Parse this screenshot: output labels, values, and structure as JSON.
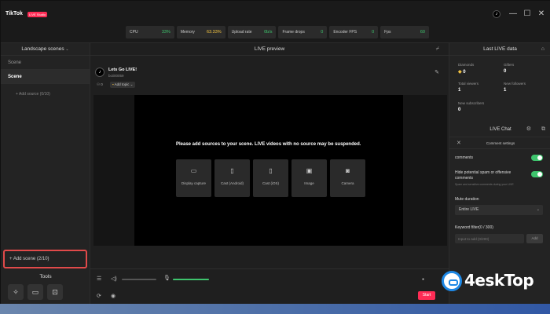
{
  "titlebar": {
    "app_name": "TikTok",
    "badge": "LIVE Studio",
    "tiktok_icon": "♪",
    "minimize": "—",
    "maximize": "☐",
    "close": "✕"
  },
  "stats": [
    {
      "label": "CPU",
      "value": "33%"
    },
    {
      "label": "Memory",
      "value": "63.33%"
    },
    {
      "label": "Upload rate",
      "value": "0b/s"
    },
    {
      "label": "Frame drops",
      "value": "0"
    },
    {
      "label": "Encoder FPS",
      "value": "0"
    },
    {
      "label": "Fps",
      "value": "60"
    }
  ],
  "left": {
    "header": "Landscape scenes",
    "scenes": [
      "Scene",
      "Scene"
    ],
    "add_source": "Add source (0/10)",
    "add_scene": "Add scene (2/10)",
    "tools_title": "Tools"
  },
  "center": {
    "header": "LIVE preview",
    "stream_title": "Lets Go LIVE!",
    "username": "boii00059",
    "viewers": "0",
    "add_topic": "Add topic",
    "message": "Please add sources to your scene. LIVE videos with no source may be suspended.",
    "tiles": [
      {
        "icon": "monitor-icon",
        "label": "Display capture"
      },
      {
        "icon": "phone-icon",
        "label": "Cast (Android)"
      },
      {
        "icon": "phone-icon",
        "label": "Cast (iOS)"
      },
      {
        "icon": "image-icon",
        "label": "Image"
      },
      {
        "icon": "camera-icon",
        "label": "Camera"
      }
    ],
    "start_label": "Start",
    "volume_level": 0,
    "mic_level": 1
  },
  "right": {
    "header": "Last LIVE data",
    "metrics": [
      {
        "label": "Diamonds",
        "value": "0"
      },
      {
        "label": "Gifters",
        "value": "0"
      },
      {
        "label": "Total viewers",
        "value": "1"
      },
      {
        "label": "New followers",
        "value": "1"
      },
      {
        "label": "New subscribers",
        "value": "0"
      }
    ],
    "chat_title": "LIVE Chat",
    "comment_settings": "Comment settings",
    "comments_label": "comments",
    "hide_spam_label": "Hide potential spam or offensive comments",
    "hide_spam_sub": "Spam and sensitive comments during your LIVE",
    "mute_duration_label": "Mute duration",
    "mute_duration_value": "Entire LIVE",
    "keyword_label": "Keyword filter(0 / 300)",
    "keyword_placeholder": "Input to add (0/200)",
    "keyword_add": "Add"
  },
  "watermark": {
    "text": "4eskTop"
  },
  "colors": {
    "accent_green": "#3ec46d",
    "brand_red": "#fe2c55",
    "highlight_red": "#e14a4a"
  }
}
